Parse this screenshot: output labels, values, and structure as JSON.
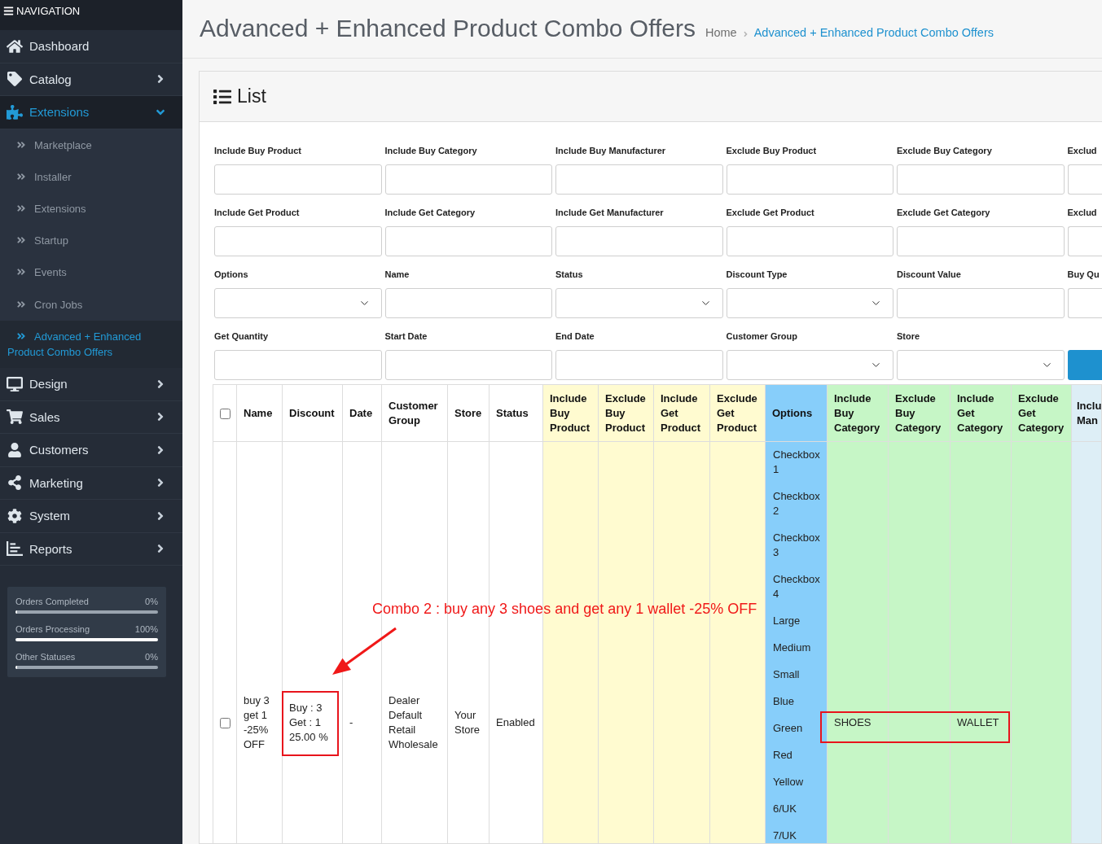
{
  "sidebar": {
    "header": {
      "title": "NAVIGATION"
    },
    "menu": [
      {
        "label": "Dashboard",
        "kind": "link",
        "selected": false
      },
      {
        "label": "Catalog",
        "kind": "group",
        "expanded": false,
        "selected": false
      },
      {
        "label": "Extensions",
        "kind": "group",
        "expanded": true,
        "selected": true,
        "children": [
          {
            "label": "Marketplace",
            "selected": false
          },
          {
            "label": "Installer",
            "selected": false
          },
          {
            "label": "Extensions",
            "selected": false
          },
          {
            "label": "Startup",
            "selected": false
          },
          {
            "label": "Events",
            "selected": false
          },
          {
            "label": "Cron Jobs",
            "selected": false
          },
          {
            "label": "Advanced + Enhanced Product Combo Offers",
            "selected": true
          }
        ]
      },
      {
        "label": "Design",
        "kind": "group",
        "expanded": false,
        "selected": false
      },
      {
        "label": "Sales",
        "kind": "group",
        "expanded": false,
        "selected": false
      },
      {
        "label": "Customers",
        "kind": "group",
        "expanded": false,
        "selected": false
      },
      {
        "label": "Marketing",
        "kind": "group",
        "expanded": false,
        "selected": false
      },
      {
        "label": "System",
        "kind": "group",
        "expanded": false,
        "selected": false
      },
      {
        "label": "Reports",
        "kind": "group",
        "expanded": false,
        "selected": false
      }
    ],
    "stats": [
      {
        "label": "Orders Completed",
        "value": "0%",
        "level": 0
      },
      {
        "label": "Orders Processing",
        "value": "100%",
        "level": 1
      },
      {
        "label": "Other Statuses",
        "value": "0%",
        "level": 0
      }
    ]
  },
  "page": {
    "title": "Advanced + Enhanced Product Combo Offers",
    "breadcrumbs": [
      {
        "label": "Home",
        "current": false
      },
      {
        "label": "Advanced + Enhanced Product Combo Offers",
        "current": true
      }
    ]
  },
  "panel": {
    "title": "List",
    "filters": [
      {
        "label": "Include Buy Product",
        "kind": "text"
      },
      {
        "label": "Include Buy Category",
        "kind": "text"
      },
      {
        "label": "Include Buy Manufacturer",
        "kind": "text"
      },
      {
        "label": "Exclude Buy Product",
        "kind": "text"
      },
      {
        "label": "Exclude Buy Category",
        "kind": "text"
      },
      {
        "label": "Exclud",
        "kind": "text"
      },
      {
        "label": "Include Get Product",
        "kind": "text"
      },
      {
        "label": "Include Get Category",
        "kind": "text"
      },
      {
        "label": "Include Get Manufacturer",
        "kind": "text"
      },
      {
        "label": "Exclude Get Product",
        "kind": "text"
      },
      {
        "label": "Exclude Get Category",
        "kind": "text"
      },
      {
        "label": "Exclud",
        "kind": "text"
      },
      {
        "label": "Options",
        "kind": "select"
      },
      {
        "label": "Name",
        "kind": "text"
      },
      {
        "label": "Status",
        "kind": "select"
      },
      {
        "label": "Discount Type",
        "kind": "select"
      },
      {
        "label": "Discount Value",
        "kind": "text"
      },
      {
        "label": "Buy Qu",
        "kind": "text"
      },
      {
        "label": "Get Quantity",
        "kind": "text"
      },
      {
        "label": "Start Date",
        "kind": "text"
      },
      {
        "label": "End Date",
        "kind": "text"
      },
      {
        "label": "Customer Group",
        "kind": "select"
      },
      {
        "label": "Store",
        "kind": "select"
      },
      {
        "kind": "button"
      }
    ],
    "table": {
      "select_all": {
        "checked": false
      },
      "columns": [
        {
          "label": "Name",
          "kind": "text",
          "color": "#ffffff"
        },
        {
          "label": "Discount",
          "kind": "text",
          "color": "#ffffff"
        },
        {
          "label": "Date",
          "kind": "text",
          "color": "#ffffff"
        },
        {
          "label": "Customer Group",
          "kind": "text",
          "color": "#ffffff"
        },
        {
          "label": "Store",
          "kind": "text",
          "color": "#ffffff"
        },
        {
          "label": "Status",
          "kind": "text",
          "color": "#ffffff"
        },
        {
          "label": "Include Buy Product",
          "kind": "text",
          "color": "#fffbd0"
        },
        {
          "label": "Exclude Buy Product",
          "kind": "text",
          "color": "#fffbd0"
        },
        {
          "label": "Include Get Product",
          "kind": "text",
          "color": "#fffbd0"
        },
        {
          "label": "Exclude Get Product",
          "kind": "text",
          "color": "#fffbd0"
        },
        {
          "label": "Options",
          "kind": "list",
          "color": "#87cefa"
        },
        {
          "label": "Include Buy Category",
          "kind": "text",
          "color": "#c6f6c6"
        },
        {
          "label": "Exclude Buy Category",
          "kind": "text",
          "color": "#c6f6c6"
        },
        {
          "label": "Include Get Category",
          "kind": "text",
          "color": "#c6f6c6"
        },
        {
          "label": "Exclude Get Category",
          "kind": "text",
          "color": "#c6f6c6"
        },
        {
          "label": "Inclu Man",
          "kind": "text",
          "color": "#ddeef6"
        }
      ],
      "rows": [
        {
          "checked": false,
          "name": "buy 3 get 1 -25% OFF",
          "discount": [
            "Buy : 3",
            "Get : 1",
            "25.00 %"
          ],
          "date": "-",
          "customer_group": [
            "Dealer",
            "Default",
            "Retail",
            "Wholesale"
          ],
          "store": "Your Store",
          "status": "Enabled",
          "options": [
            "Checkbox 1",
            "Checkbox 2",
            "Checkbox 3",
            "Checkbox 4",
            "Large",
            "Medium",
            "Small",
            "Blue",
            "Green",
            "Red",
            "Yellow",
            "6/UK",
            "7/UK"
          ],
          "include_buy_category": "SHOES",
          "include_get_category": "WALLET"
        }
      ]
    }
  },
  "annotation": {
    "text": "Combo 2 : buy any 3 shoes and get any 1 wallet -25% OFF"
  }
}
